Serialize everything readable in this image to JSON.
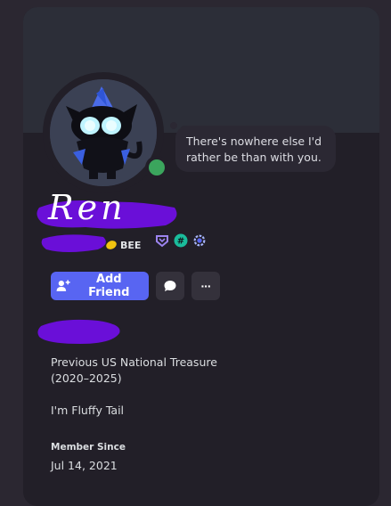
{
  "profile": {
    "custom_status": "There's nowhere else I'd rather be than with you.",
    "display_name": "Ren",
    "tag_label": "BEE",
    "status": "online",
    "badges": [
      "hypesquad-badge",
      "hashtag-badge",
      "quest-badge"
    ]
  },
  "actions": {
    "add_friend_label": "Add Friend",
    "more_label": "···"
  },
  "bio": {
    "line1": "Previous US National Treasure",
    "line2": "(2020–2025)",
    "line3": "I'm Fluffy Tail"
  },
  "member": {
    "label": "Member Since",
    "date": "Jul 14, 2021"
  },
  "colors": {
    "accent": "#5865f2",
    "online": "#3ba55d",
    "redaction": "#6a0fd8"
  }
}
